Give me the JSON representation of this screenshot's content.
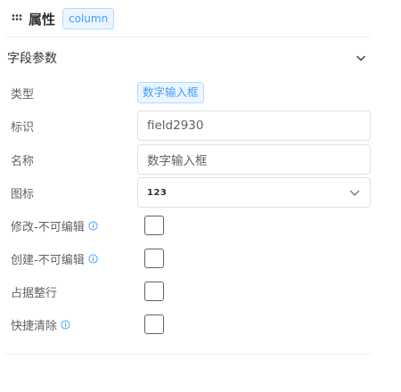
{
  "header": {
    "title": "属性",
    "tag": "column"
  },
  "section": {
    "title": "字段参数"
  },
  "fields": {
    "type_label": "类型",
    "type_value": "数字输入框",
    "id_label": "标识",
    "id_value": "field2930",
    "name_label": "名称",
    "name_value": "数字输入框",
    "icon_label": "图标",
    "icon_value": "123",
    "edit_readonly_label": "修改-不可编辑",
    "create_readonly_label": "创建-不可编辑",
    "full_row_label": "占据整行",
    "quick_clear_label": "快捷清除"
  },
  "colors": {
    "accent": "#409eff",
    "border": "#dcdfe6"
  },
  "icons": [
    "drag-grip-icon",
    "chevron-down-icon",
    "info-icon"
  ]
}
